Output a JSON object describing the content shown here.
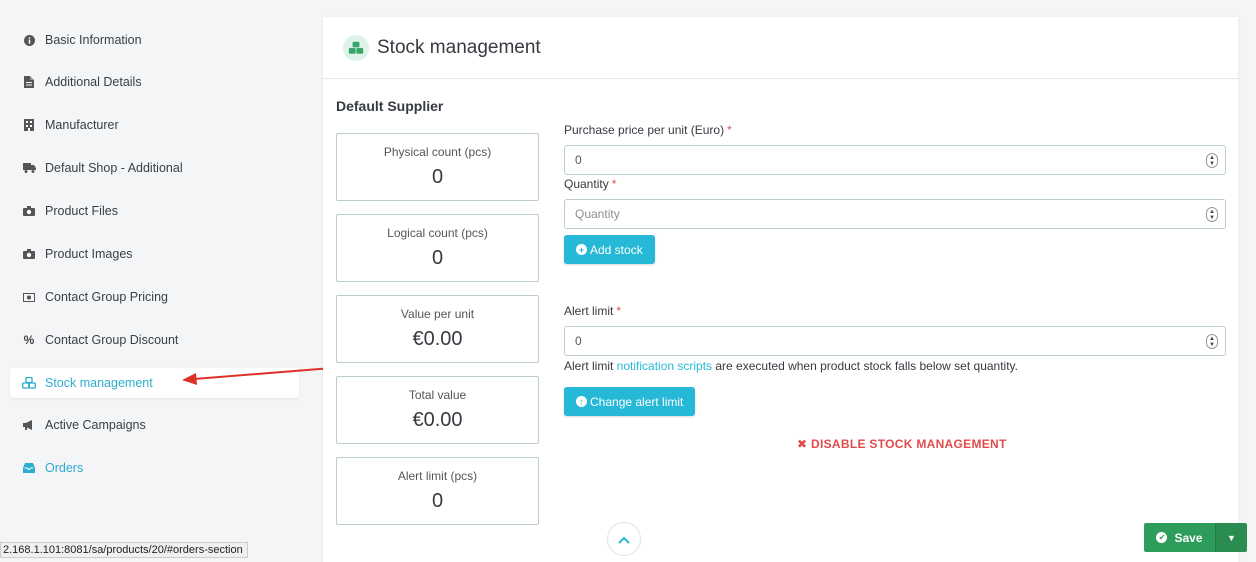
{
  "sidebar": {
    "items": [
      {
        "label": "Basic Information",
        "icon": "info-circle-icon"
      },
      {
        "label": "Additional Details",
        "icon": "file-icon"
      },
      {
        "label": "Manufacturer",
        "icon": "building-icon"
      },
      {
        "label": "Default Shop - Additional",
        "icon": "truck-icon"
      },
      {
        "label": "Product Files",
        "icon": "camera-icon"
      },
      {
        "label": "Product Images",
        "icon": "camera-icon"
      },
      {
        "label": "Contact Group Pricing",
        "icon": "money-icon"
      },
      {
        "label": "Contact Group Discount",
        "icon": "percent-icon"
      },
      {
        "label": "Stock management",
        "icon": "cubes-icon"
      },
      {
        "label": "Active Campaigns",
        "icon": "bullhorn-icon"
      },
      {
        "label": "Orders",
        "icon": "inbox-icon"
      }
    ],
    "active_index": 8
  },
  "panel": {
    "title": "Stock management",
    "section_title": "Default Supplier"
  },
  "stats": [
    {
      "label": "Physical count (pcs)",
      "value": "0"
    },
    {
      "label": "Logical count (pcs)",
      "value": "0"
    },
    {
      "label": "Value per unit",
      "value": "€0.00"
    },
    {
      "label": "Total value",
      "value": "€0.00"
    },
    {
      "label": "Alert limit (pcs)",
      "value": "0"
    }
  ],
  "form": {
    "price_label": "Purchase price per unit (Euro)",
    "price_value": "0",
    "quantity_label": "Quantity",
    "quantity_placeholder": "Quantity",
    "add_stock_label": "Add stock",
    "alert_label": "Alert limit",
    "alert_value": "0",
    "help_prefix": "Alert limit ",
    "help_link": "notification scripts",
    "help_suffix": " are executed when product stock falls below set quantity.",
    "change_alert_label": "Change alert limit",
    "disable_label": "DISABLE STOCK MANAGEMENT",
    "required_mark": "*"
  },
  "status_url": "2.168.1.101:8081/sa/products/20/#orders-section",
  "save": {
    "label": "Save"
  },
  "colors": {
    "accent": "#25b9d7",
    "save_green": "#2e9c5a",
    "danger": "#e14b4b",
    "annotation_arrow": "#e0302a"
  }
}
